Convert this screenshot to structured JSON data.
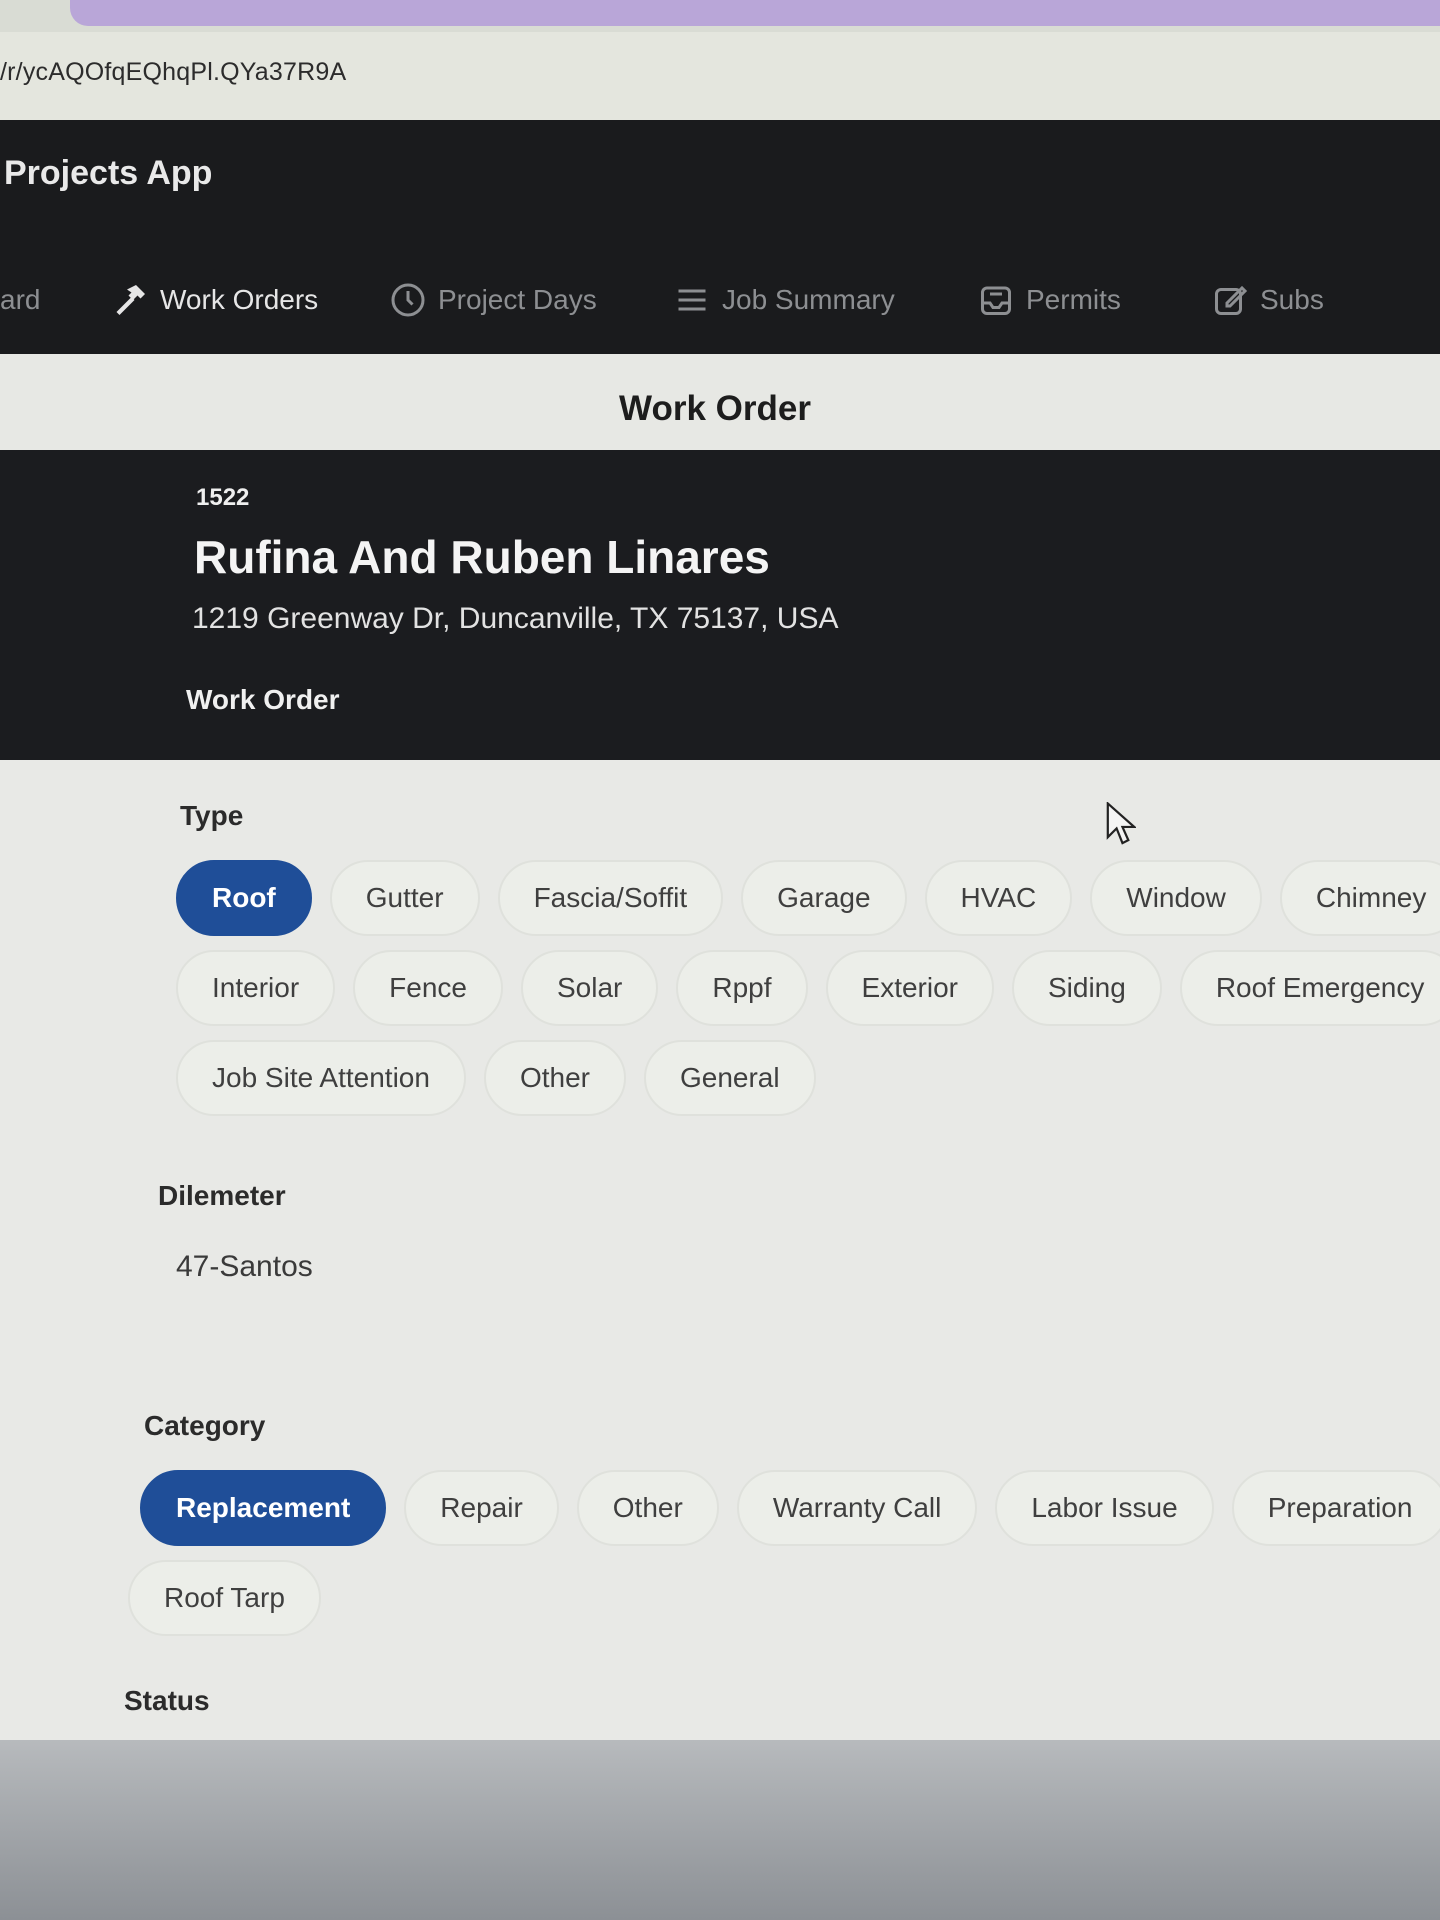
{
  "browser": {
    "url": "/r/ycAQOfqEQhqPl.QYa37R9A"
  },
  "app": {
    "title": "Projects App"
  },
  "nav": {
    "items": [
      {
        "label": "ard",
        "icon": "dashboard-icon"
      },
      {
        "label": "Work Orders",
        "icon": "hammer-icon",
        "active": true
      },
      {
        "label": "Project Days",
        "icon": "clock-icon"
      },
      {
        "label": "Job Summary",
        "icon": "list-icon"
      },
      {
        "label": "Permits",
        "icon": "inbox-icon"
      },
      {
        "label": "Subs",
        "icon": "edit-icon"
      }
    ]
  },
  "page": {
    "title": "Work Order"
  },
  "job": {
    "number": "1522",
    "name": "Rufina And Ruben Linares",
    "address": "1219 Greenway Dr, Duncanville, TX 75137, USA",
    "section": "Work Order"
  },
  "form": {
    "type": {
      "label": "Type",
      "options": [
        "Roof",
        "Gutter",
        "Fascia/Soffit",
        "Garage",
        "HVAC",
        "Window",
        "Chimney",
        "Interior",
        "Fence",
        "Solar",
        "Rppf",
        "Exterior",
        "Siding",
        "Roof Emergency",
        "Job Site Attention",
        "Other",
        "General"
      ],
      "selected": "Roof"
    },
    "dilemeter": {
      "label": "Dilemeter",
      "value": "47-Santos"
    },
    "category": {
      "label": "Category",
      "options": [
        "Replacement",
        "Repair",
        "Other",
        "Warranty Call",
        "Labor Issue",
        "Preparation",
        "Roof Tarp"
      ],
      "selected": "Replacement"
    },
    "status": {
      "label": "Status"
    }
  },
  "colors": {
    "accent": "#1f4e98",
    "appbar": "#1a1b1d",
    "background": "#e8e9e6"
  }
}
